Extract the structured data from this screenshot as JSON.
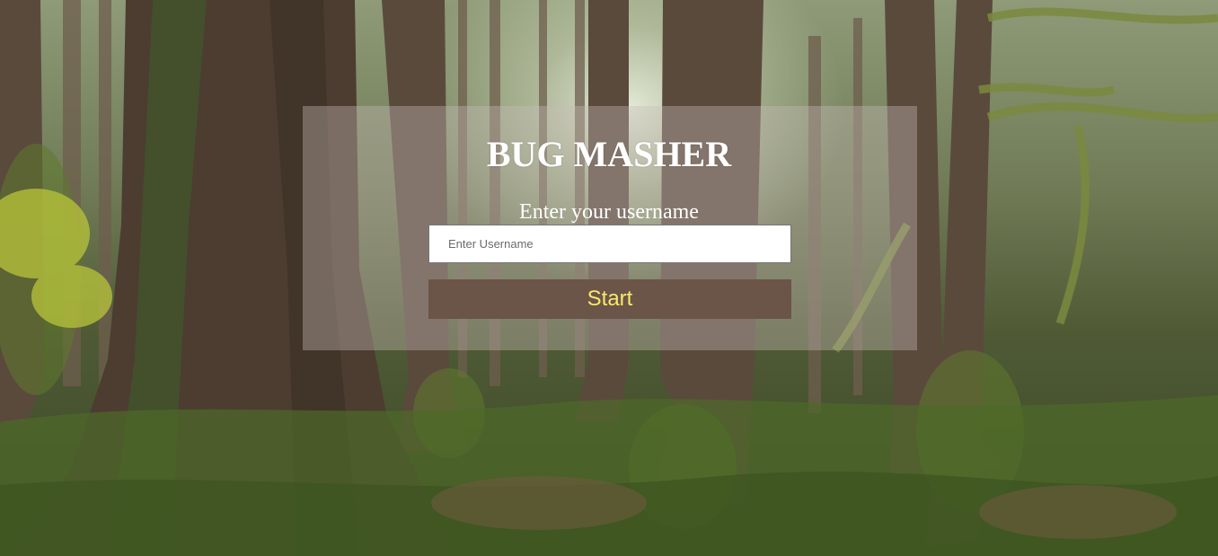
{
  "app": {
    "title": "BUG MASHER"
  },
  "login": {
    "prompt": "Enter your username",
    "username_placeholder": "Enter Username",
    "username_value": "",
    "start_label": "Start"
  },
  "colors": {
    "panel_background": "#c8beb9",
    "button_background": "#6b5448",
    "button_text": "#f5e96b",
    "title_text": "#ffffff"
  },
  "background": {
    "description_icon": "forest-background-image"
  }
}
